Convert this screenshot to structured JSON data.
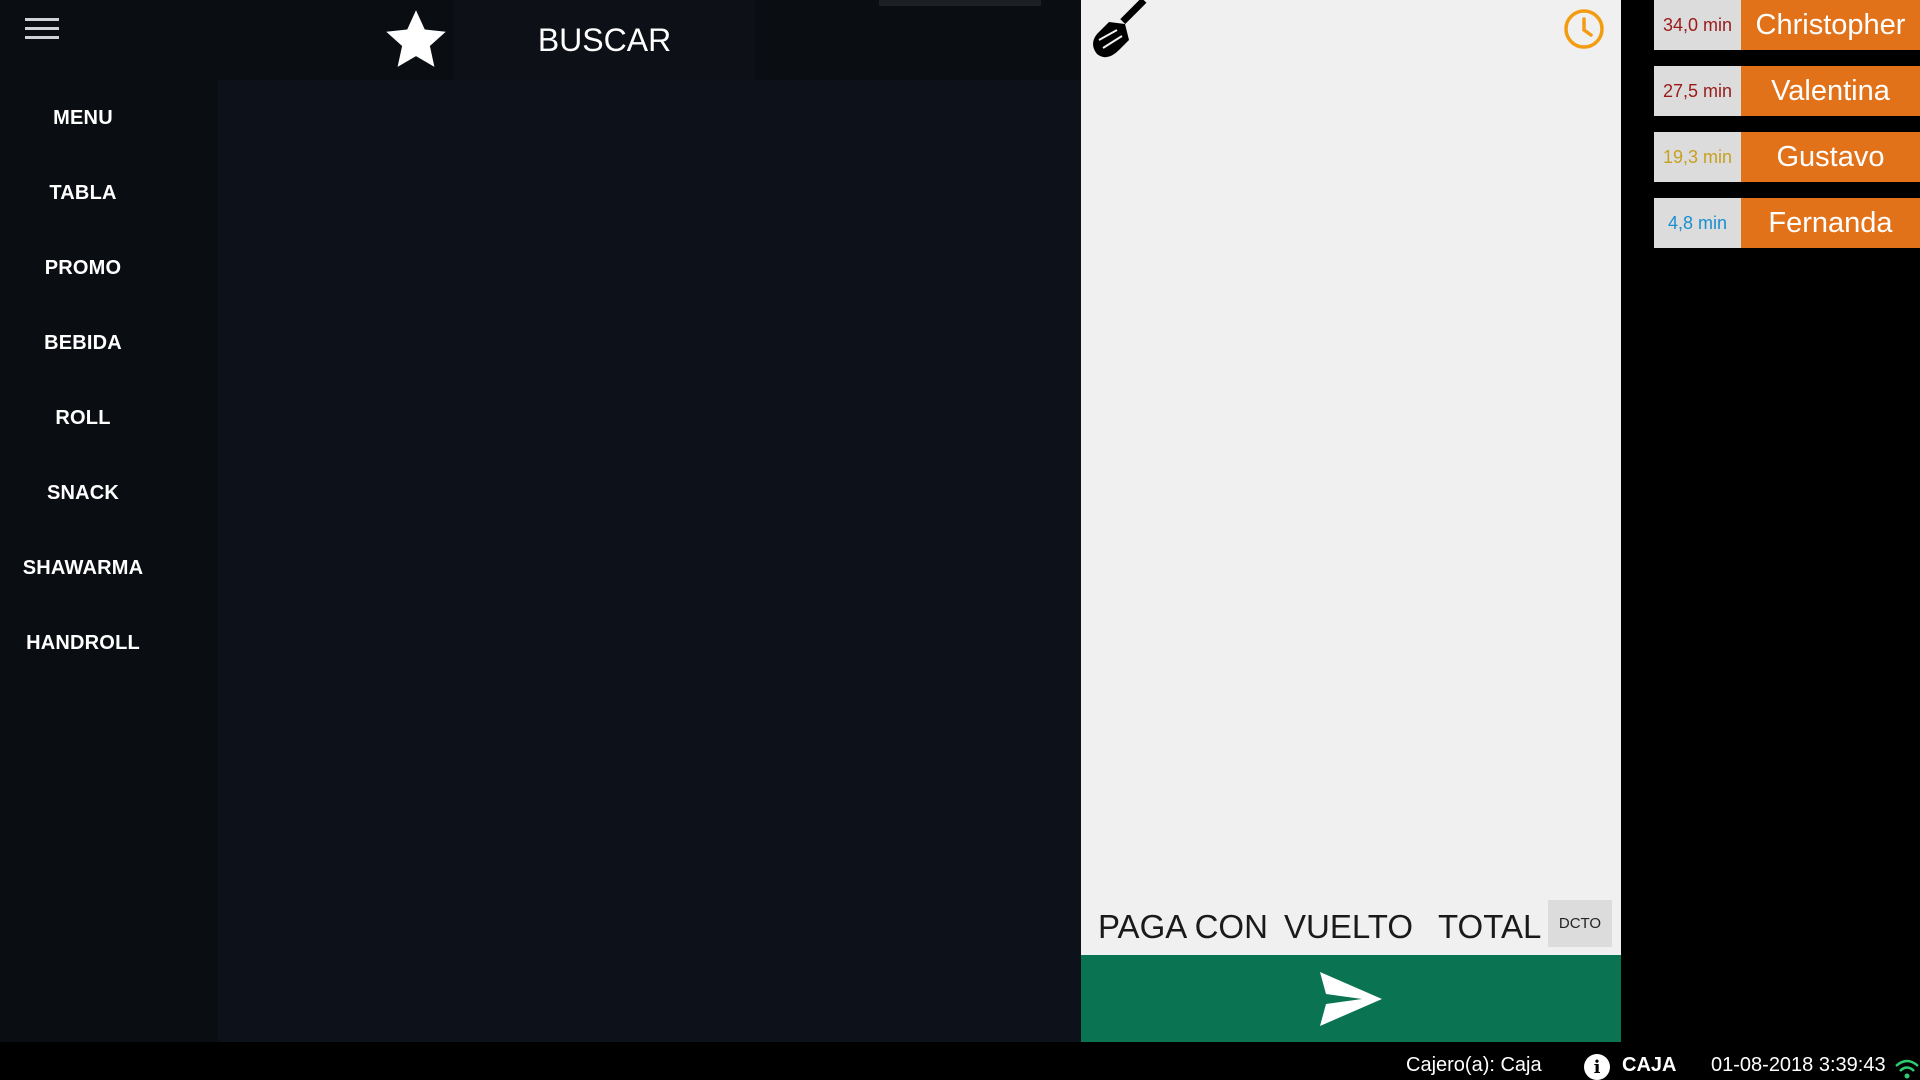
{
  "sidebar": {
    "menu_icon": "hamburger-menu-icon",
    "items": [
      {
        "label": "MENU"
      },
      {
        "label": "TABLA"
      },
      {
        "label": "PROMO"
      },
      {
        "label": "BEBIDA"
      },
      {
        "label": "ROLL"
      },
      {
        "label": "SNACK"
      },
      {
        "label": "SHAWARMA"
      },
      {
        "label": "HANDROLL"
      }
    ]
  },
  "topbar": {
    "favorites_icon": "star-icon",
    "search_label": "BUSCAR"
  },
  "order": {
    "clear_icon": "broom-icon",
    "history_icon": "clock-icon",
    "pay_with_label": "PAGA CON",
    "change_label": "VUELTO",
    "total_label": "TOTAL",
    "discount_label": "DCTO",
    "send_icon": "send-arrow-icon"
  },
  "waiting_orders": [
    {
      "time": "34,0 min",
      "name": "Christopher",
      "time_color": "#9a1a1a"
    },
    {
      "time": "27,5 min",
      "name": "Valentina",
      "time_color": "#9a1a1a"
    },
    {
      "time": "19,3 min",
      "name": "Gustavo",
      "time_color": "#c8a020"
    },
    {
      "time": "4,8 min",
      "name": "Fernanda",
      "time_color": "#1a8fd0"
    }
  ],
  "status": {
    "cashier": "Cajero(a): Caja",
    "info_icon": "info-icon",
    "register": "CAJA",
    "datetime": "01-08-2018 3:39:43",
    "connection_icon": "wifi-icon"
  },
  "colors": {
    "accent_orange": "#e2721a",
    "send_green": "#0a7352",
    "sidebar_bg": "#0a0d12",
    "main_bg": "#0d111a",
    "order_bg": "#f0f0f0"
  }
}
